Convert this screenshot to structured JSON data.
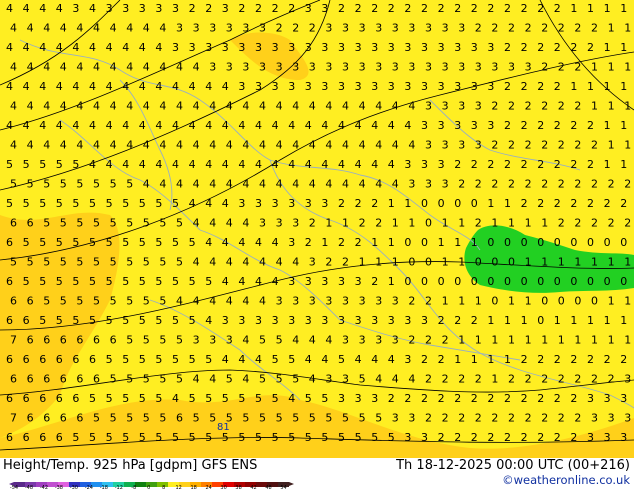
{
  "footer": {
    "title": "Height/Temp. 925 hPa [gdpm] GFS ENS",
    "datetime": "Th 18-12-2025 00:00 UTC (00+216)",
    "credit": "©weatheronline.co.uk"
  },
  "colors": {
    "land_yellow": "#ffee22",
    "sea_orange": "#ffd01a",
    "green_area": "#22d022",
    "contour_line": "#000000",
    "border_line": "#9ab0c0"
  },
  "map": {
    "station_label": "81",
    "rows": [
      "44443433333223222233222222222222221111",
      "44444444443333332223333333332222222211",
      "44444444443333333333333333333322222211",
      "44444444444433333333333333333333222111",
      "44444444444444333333333333333322221111",
      "44444444444444444444444443333222222111",
      "44444444444444444444444443333322222211",
      "44444444444444444444444443333222222211",
      "55555444444444444444444433322222222211",
      "55555555444444444444444433322222222222",
      "55555555555444333333222110000112222222",
      "66555555555444433321122110112111122222",
      "65555555555544444321221100111000000000",
      "55555555555444444432211100110001111111",
      "65555555555554444333332100000000000000",
      "66555555554444443333333322111011000011",
      "66555555555543333333333333222111011111",
      "76666665555333455444333322211111111111",
      "66666655555554445544544432211112222222",
      "66666655555445455543354442222122222223",
      "66666555554555555455333222222222222333",
      "76666555556555555555555332222222222333",
      "66665555555555555555555533222222222333"
    ]
  },
  "scale": {
    "colors": [
      "#5a2a8a",
      "#7a3aaa",
      "#a040c0",
      "#c050d0",
      "#e060e0",
      "#3030c0",
      "#2060e0",
      "#2090f0",
      "#30c0f0",
      "#20d0a0",
      "#10b050",
      "#108010",
      "#40a010",
      "#80c000",
      "#ffee22",
      "#ffd01a",
      "#ffb000",
      "#ff8000",
      "#ff4000",
      "#e00000",
      "#b00000",
      "#900000",
      "#6a0a0a",
      "#501010",
      "#402020"
    ],
    "labels": [
      "-54",
      "-48",
      "-42",
      "-38",
      "-30",
      "-24",
      "-18",
      "-12",
      "-8",
      "0",
      "8",
      "12",
      "18",
      "24",
      "30",
      "38",
      "42",
      "48",
      "54"
    ]
  }
}
